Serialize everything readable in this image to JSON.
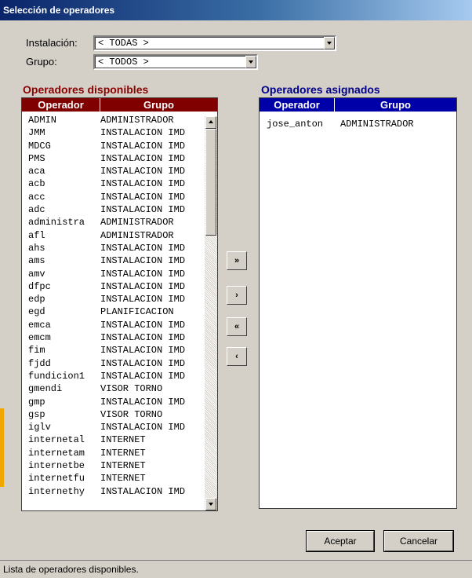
{
  "window": {
    "title": "Selección de operadores"
  },
  "filters": {
    "instalacion_label": "Instalación:",
    "instalacion_value": "< TODAS >",
    "grupo_label": "Grupo:",
    "grupo_value": "< TODOS >"
  },
  "available": {
    "title": "Operadores disponibles",
    "col_operador": "Operador",
    "col_grupo": "Grupo",
    "title_color": "#8b0000",
    "header_color": "#800000",
    "rows": [
      {
        "op": "ADMIN",
        "grupo": "ADMINISTRADOR"
      },
      {
        "op": "JMM",
        "grupo": "INSTALACION IMD"
      },
      {
        "op": "MDCG",
        "grupo": "INSTALACION IMD"
      },
      {
        "op": "PMS",
        "grupo": "INSTALACION IMD"
      },
      {
        "op": "aca",
        "grupo": "INSTALACION IMD"
      },
      {
        "op": "acb",
        "grupo": "INSTALACION IMD"
      },
      {
        "op": "acc",
        "grupo": "INSTALACION IMD"
      },
      {
        "op": "adc",
        "grupo": "INSTALACION IMD"
      },
      {
        "op": "administra",
        "grupo": "ADMINISTRADOR"
      },
      {
        "op": "afl",
        "grupo": "ADMINISTRADOR"
      },
      {
        "op": "ahs",
        "grupo": "INSTALACION IMD"
      },
      {
        "op": "ams",
        "grupo": "INSTALACION IMD"
      },
      {
        "op": "amv",
        "grupo": "INSTALACION IMD"
      },
      {
        "op": "dfpc",
        "grupo": "INSTALACION IMD"
      },
      {
        "op": "edp",
        "grupo": "INSTALACION IMD"
      },
      {
        "op": "egd",
        "grupo": "PLANIFICACION"
      },
      {
        "op": "emca",
        "grupo": "INSTALACION IMD"
      },
      {
        "op": "emcm",
        "grupo": "INSTALACION IMD"
      },
      {
        "op": "fim",
        "grupo": "INSTALACION IMD"
      },
      {
        "op": "fjdd",
        "grupo": "INSTALACION IMD"
      },
      {
        "op": "fundicion1",
        "grupo": "INSTALACION IMD"
      },
      {
        "op": "gmendi",
        "grupo": "VISOR TORNO"
      },
      {
        "op": "gmp",
        "grupo": "INSTALACION IMD"
      },
      {
        "op": "gsp",
        "grupo": "VISOR TORNO"
      },
      {
        "op": "iglv",
        "grupo": "INSTALACION IMD"
      },
      {
        "op": "internetal",
        "grupo": "INTERNET"
      },
      {
        "op": "internetam",
        "grupo": "INTERNET"
      },
      {
        "op": "internetbe",
        "grupo": "INTERNET"
      },
      {
        "op": "internetfu",
        "grupo": "INTERNET"
      },
      {
        "op": "internethy",
        "grupo": "INSTALACION IMD"
      }
    ]
  },
  "assigned": {
    "title": "Operadores asignados",
    "col_operador": "Operador",
    "col_grupo": "Grupo",
    "title_color": "#00008b",
    "header_color": "#0000a8",
    "rows": [
      {
        "op": "jose_anton",
        "grupo": "ADMINISTRADOR"
      }
    ]
  },
  "move_buttons": {
    "add_all": "»",
    "add_one": "›",
    "remove_all": "«",
    "remove_one": "‹"
  },
  "dialog_buttons": {
    "accept": "Aceptar",
    "cancel": "Cancelar"
  },
  "status": {
    "text": "Lista de operadores disponibles."
  }
}
